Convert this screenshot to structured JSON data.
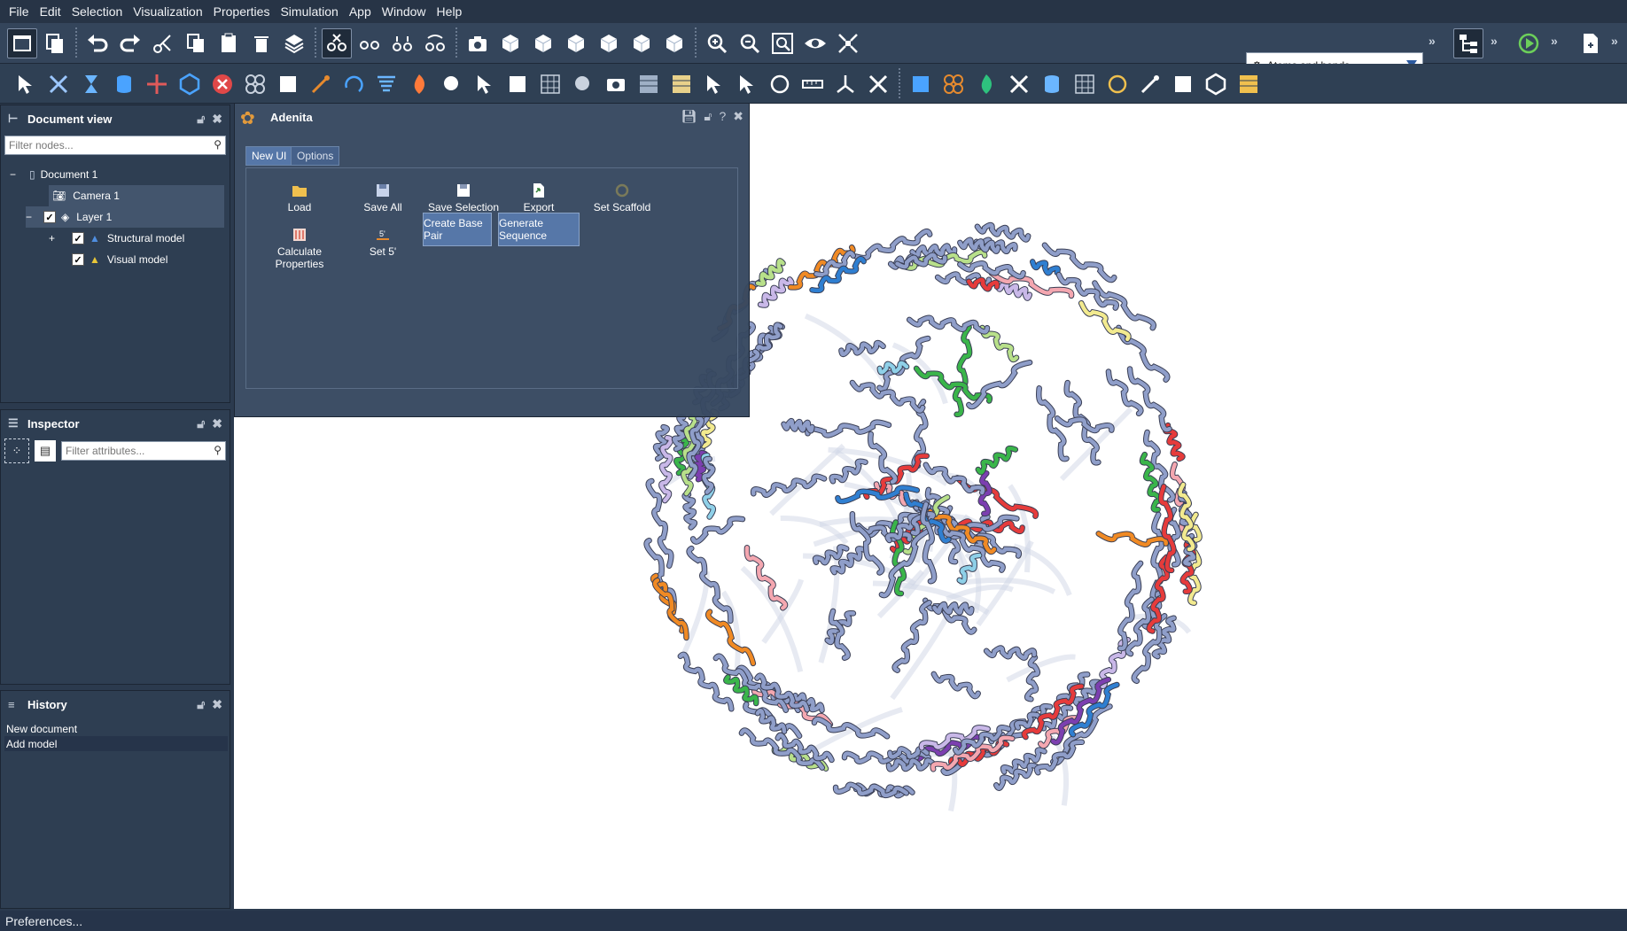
{
  "menubar": {
    "items": [
      "File",
      "Edit",
      "Selection",
      "Visualization",
      "Properties",
      "Simulation",
      "App",
      "Window",
      "Help"
    ]
  },
  "toolbar": {
    "style_select": "Atoms and bonds"
  },
  "document_view": {
    "title": "Document view",
    "filter_placeholder": "Filter nodes...",
    "tree": [
      "Document 1",
      "Camera 1",
      "Layer 1",
      "Structural model",
      "Visual model"
    ]
  },
  "inspector": {
    "title": "Inspector",
    "filter_placeholder": "Filter attributes..."
  },
  "history": {
    "title": "History",
    "items": [
      "New document",
      "Add model"
    ]
  },
  "adenita": {
    "title": "Adenita",
    "tabs": [
      "New UI",
      "Options"
    ],
    "buttons": {
      "load": "Load",
      "save_all": "Save All",
      "save_selection": "Save Selection",
      "export": "Export",
      "set_scaffold": "Set Scaffold",
      "calc_props": "Calculate Properties",
      "set5": "Set 5'",
      "create_bp": "Create Base Pair",
      "gen_seq": "Generate Sequence"
    }
  },
  "status": {
    "text": "Preferences..."
  },
  "colors": {
    "accent": "#5677a8",
    "panel": "#2e3e52",
    "strand_base": "#8f9ec9"
  }
}
